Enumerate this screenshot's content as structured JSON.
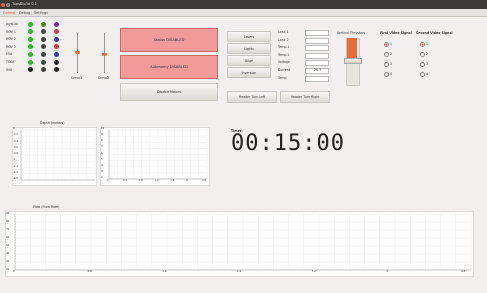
{
  "window": {
    "title": "TopsBlo3d 0.1"
  },
  "tabs": [
    {
      "label": "Control"
    },
    {
      "label": "Debug"
    },
    {
      "label": "Settings"
    }
  ],
  "indicators": {
    "labels": [
      "Joystick",
      "ROV 1",
      "ROV 2",
      "ROV 3",
      "EVA",
      "TOBI",
      "IMU"
    ],
    "col1": [
      "#32b432",
      "#32b432",
      "#32b432",
      "#32b432",
      "#32b432",
      "#32b432",
      "#222222"
    ],
    "col2": [
      "#5a7a2a",
      "#444444",
      "#444444",
      "#444444",
      "#444444",
      "#444444",
      "#444444"
    ],
    "col3": [
      "#7a2a9a",
      "#cc3a3a",
      "#2a3aaa",
      "#cc3a3a",
      "#2a3aaa",
      "#222222",
      "#222222"
    ]
  },
  "sliders": {
    "servo1_label": "Servo1",
    "servo2_label": "Servo2",
    "servo1_value": 0.55,
    "servo2_value": 0.5
  },
  "status": {
    "status_label": "Status DISABLED",
    "autonomy_label": "Autonomy DISABLED",
    "disable_button": "Disable Motors"
  },
  "lights": {
    "buttons": [
      "Lasers",
      "Lights",
      "Bilge",
      "Inversion"
    ]
  },
  "readouts": {
    "labels": [
      "Leak 1",
      "Leak 2",
      "Temp 1",
      "Temp 2",
      "Voltage",
      "Current",
      "Temp"
    ],
    "current_value": "26.7"
  },
  "header_buttons": {
    "left": "Header Turn Left",
    "right": "Header Turn Right"
  },
  "vertical_thrusters": {
    "label": "Vertical Thrusters"
  },
  "video": {
    "first_label": "First Video Signal",
    "second_label": "Second Video Signal",
    "options": [
      "1",
      "2",
      "3",
      "4"
    ],
    "first_selected": 0,
    "second_selected": 0
  },
  "depth_chart": {
    "title": "Depth (meters)",
    "yticks": [
      "0",
      "-0.2",
      "-0.4",
      "-0.6",
      "-0.8",
      "-1",
      "-1.2",
      "-1.4",
      "-1.6"
    ]
  },
  "chart2": {
    "xticks": [
      "0",
      "0.4",
      "0.8",
      "1.2",
      "1.6",
      "2",
      "2.4"
    ],
    "yticks": [
      "10",
      "9",
      "8",
      "7",
      "6",
      "5",
      "4",
      "3",
      "2"
    ]
  },
  "timer": {
    "label": "Timer",
    "value": "00:15:00"
  },
  "flow_chart": {
    "title": "Flow (Flow Rate)",
    "yticks": [
      "90",
      "80",
      "70",
      "60",
      "50",
      "40",
      "30",
      "20"
    ],
    "xticks": [
      "0",
      "0.8",
      "1.6",
      "2.4",
      "3.2",
      "4",
      "4.8"
    ]
  }
}
